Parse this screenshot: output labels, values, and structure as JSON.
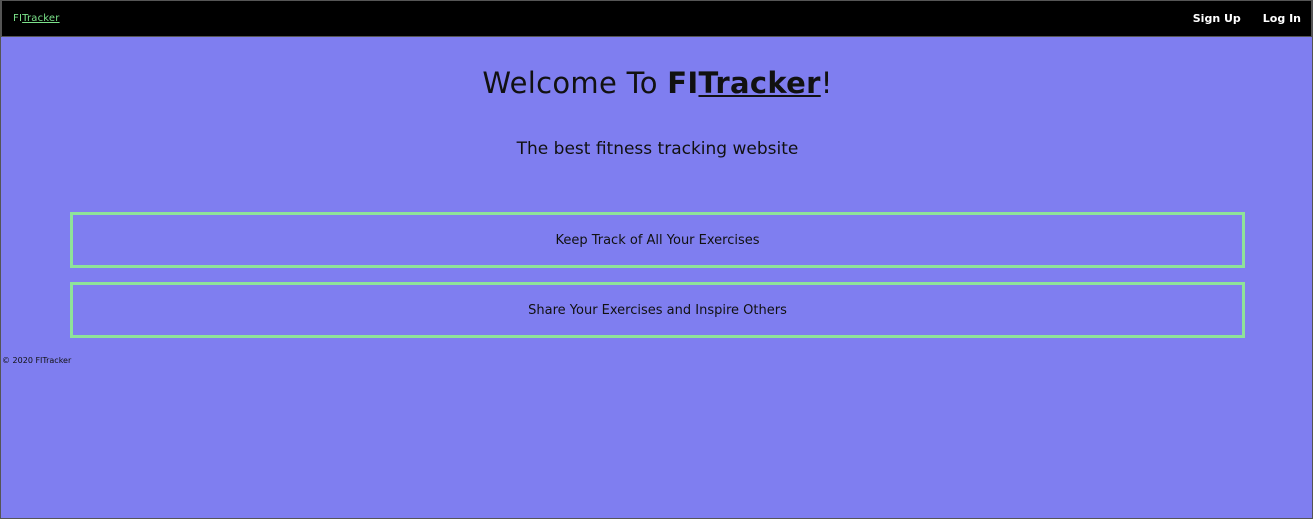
{
  "navbar": {
    "brand_prefix": "FI",
    "brand_suffix": "Tracker",
    "links": [
      "Sign Up",
      "Log In"
    ]
  },
  "hero": {
    "title_prefix": "Welcome To ",
    "title_brand_a": "FI",
    "title_brand_b": "Tracker",
    "title_suffix": "!",
    "subtitle": "The best fitness tracking website"
  },
  "features": [
    "Keep Track of All Your Exercises",
    "Share Your Exercises and Inspire Others"
  ],
  "footer": {
    "text": "© 2020 FITracker"
  },
  "colors": {
    "background": "#7f7ef0",
    "navbar": "#000000",
    "accent_green": "#8ee39a",
    "text_dark": "#111111"
  }
}
